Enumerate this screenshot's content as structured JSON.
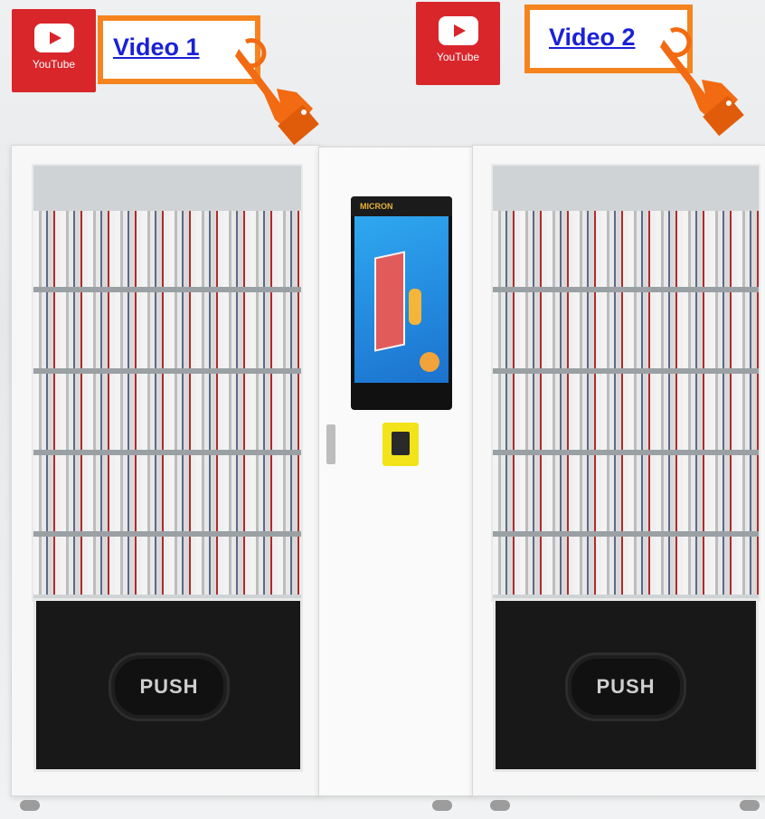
{
  "badges": [
    {
      "id": "1",
      "label": "YouTube",
      "link_text": "Video 1"
    },
    {
      "id": "2",
      "label": "YouTube",
      "link_text": "Video 2"
    }
  ],
  "machine": {
    "brand_text": "MICRON",
    "push_labels": [
      "PUSH",
      "PUSH"
    ]
  },
  "colors": {
    "youtube_red": "#d9262b",
    "accent_orange": "#f5841f",
    "link_blue": "#1a21d6"
  }
}
